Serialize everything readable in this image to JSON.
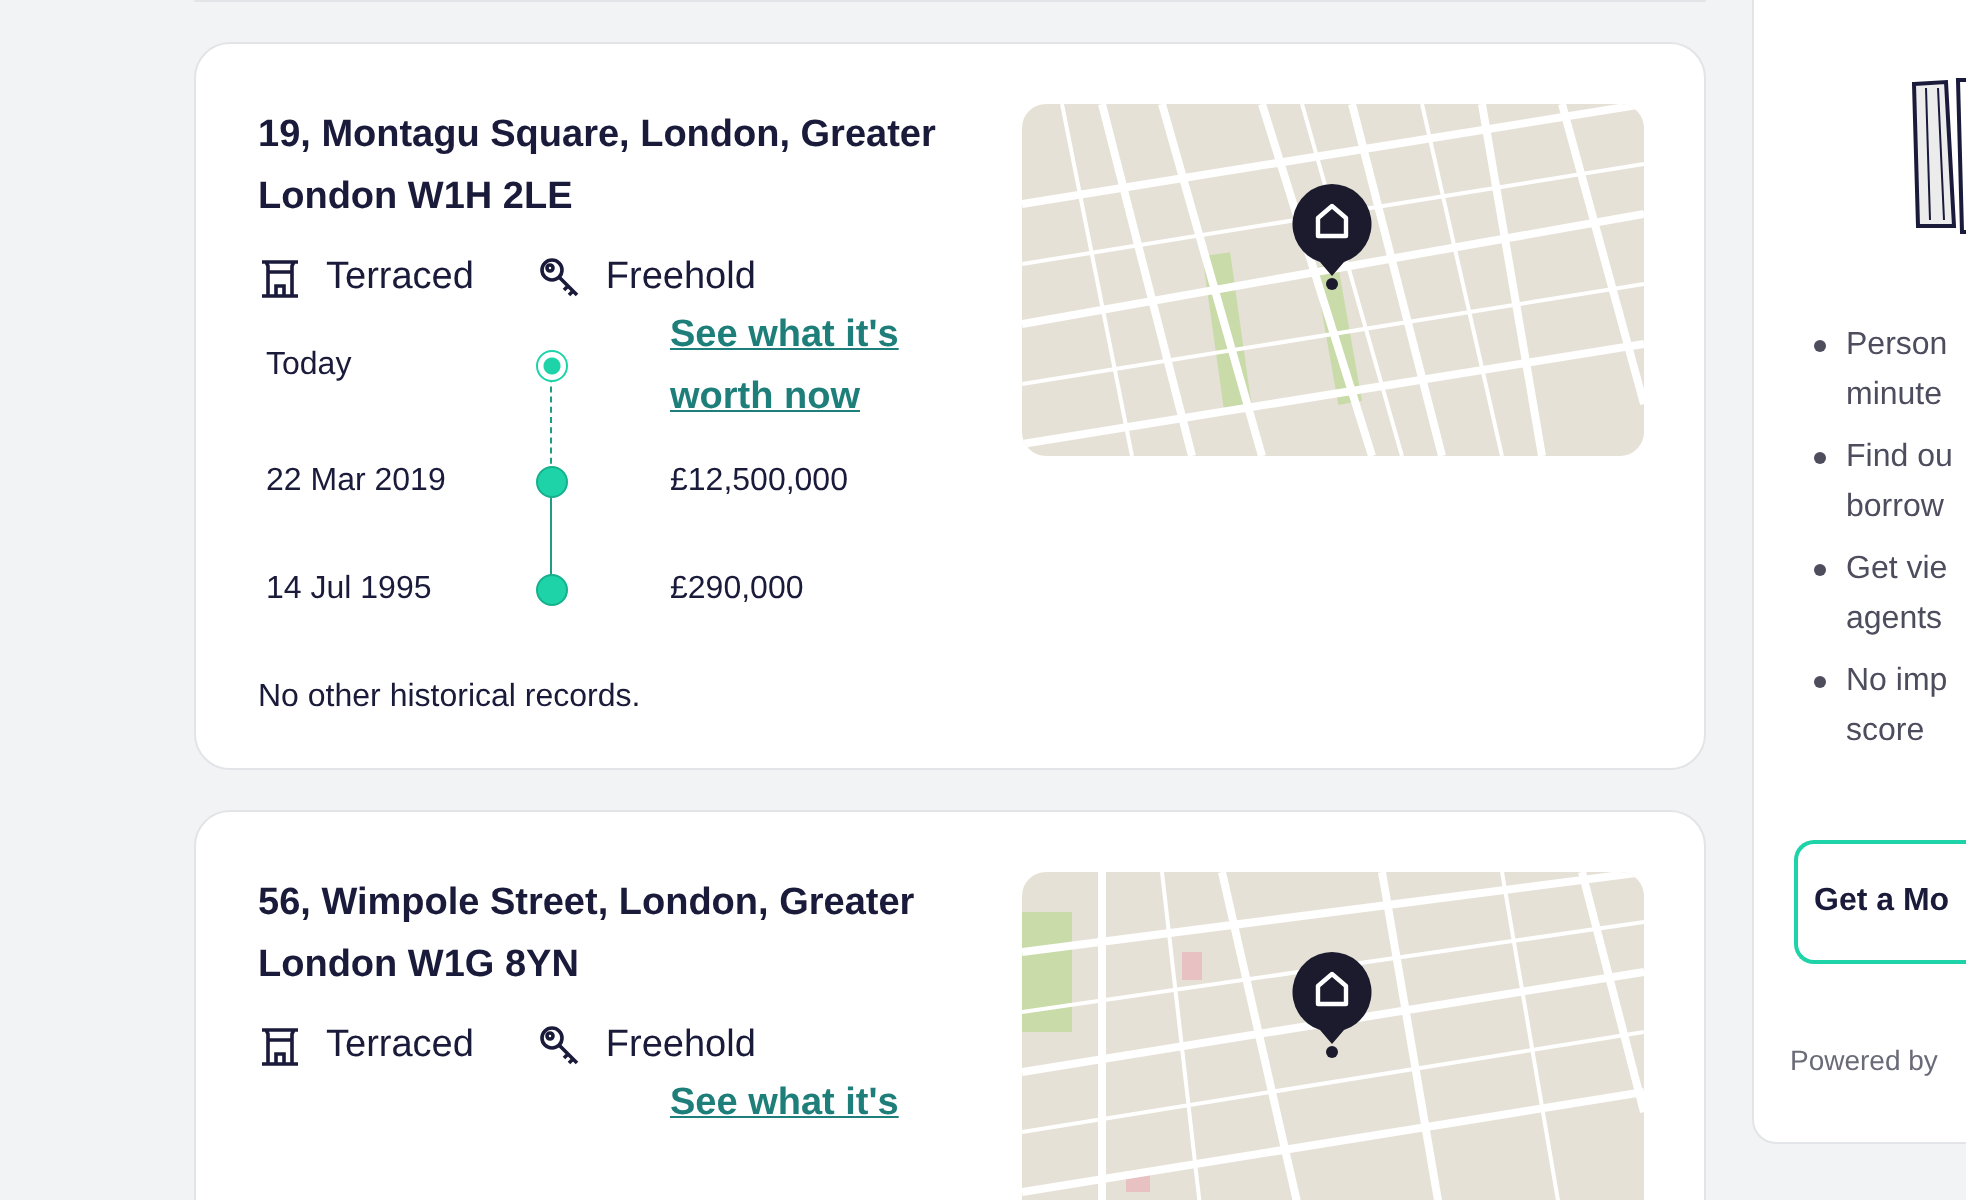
{
  "properties": [
    {
      "address": "19, Montagu Square, London, Greater London W1H 2LE",
      "tags": [
        {
          "kind": "type",
          "label": "Terraced"
        },
        {
          "kind": "tenure",
          "label": "Freehold"
        }
      ],
      "history": [
        {
          "kind": "estimate",
          "date": "Today",
          "link": "See what it's worth now"
        },
        {
          "kind": "sale",
          "date": "22 Mar 2019",
          "price": "£12,500,000"
        },
        {
          "kind": "sale",
          "date": "14 Jul 1995",
          "price": "£290,000"
        }
      ],
      "note": "No other historical records."
    },
    {
      "address": "56, Wimpole Street, London, Greater London W1G 8YN",
      "tags": [
        {
          "kind": "type",
          "label": "Terraced"
        },
        {
          "kind": "tenure",
          "label": "Freehold"
        }
      ],
      "history": [
        {
          "kind": "estimate",
          "link": "See what it's"
        }
      ]
    }
  ],
  "sidebar": {
    "bullets": [
      {
        "lines": [
          "Person",
          "minute"
        ]
      },
      {
        "lines": [
          "Find ou",
          "borrow"
        ]
      },
      {
        "lines": [
          "Get vie",
          "agents"
        ]
      },
      {
        "lines": [
          "No imp",
          "score"
        ]
      }
    ],
    "button": "Get a Mo",
    "footer": "Powered by"
  }
}
